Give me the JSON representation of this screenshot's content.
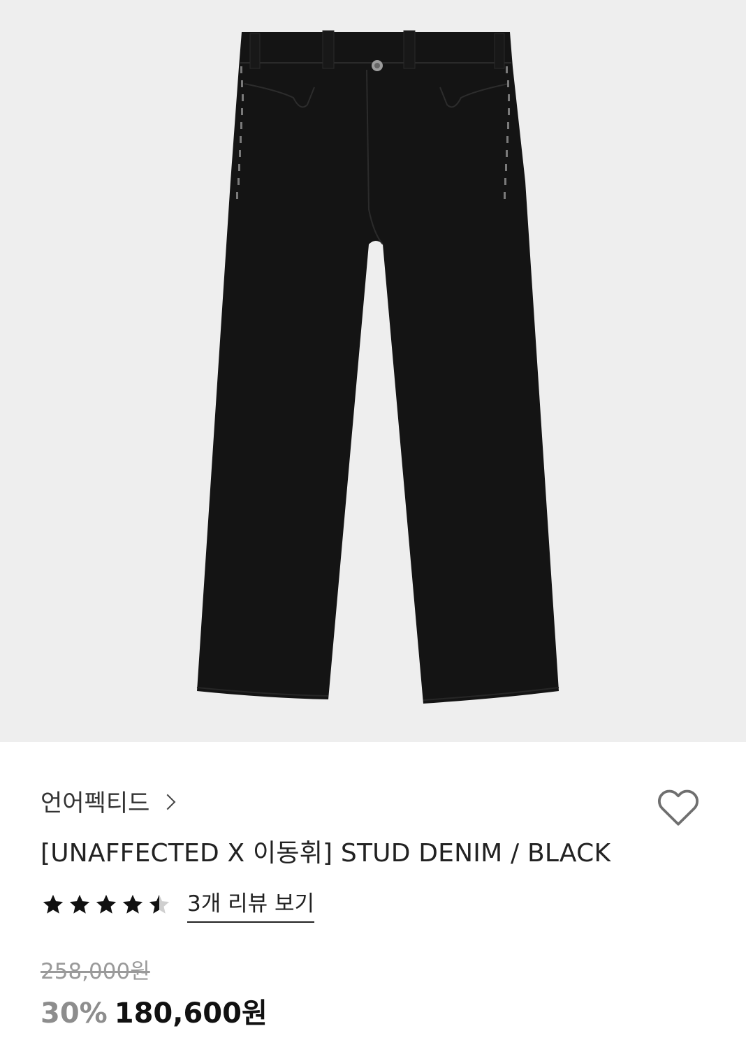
{
  "product_image": {
    "background_color": "#eeeeee",
    "subject_color": "#111111"
  },
  "brand": {
    "name": "언어펙티드"
  },
  "product": {
    "name": "[UNAFFECTED X 이동휘] STUD DENIM / BLACK"
  },
  "rating": {
    "value": 4.5,
    "max": 5,
    "review_link": "3개 리뷰 보기"
  },
  "price": {
    "original": "258,000원",
    "discount": "30%",
    "sale": "180,600원"
  },
  "icons": {
    "brand_chevron": "chevron-right-icon",
    "wishlist": "heart-outline-icon",
    "star": "star-icon"
  }
}
